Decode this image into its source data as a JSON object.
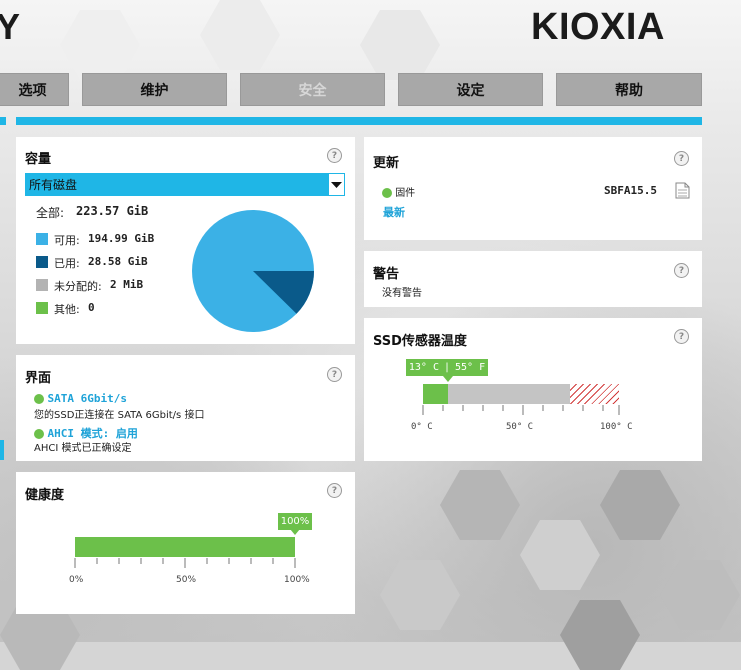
{
  "header": {
    "logo_left": "Y",
    "logo": "KIOXIA"
  },
  "nav": [
    {
      "label": "选项",
      "disabled": false
    },
    {
      "label": "维护",
      "disabled": false
    },
    {
      "label": "安全",
      "disabled": true
    },
    {
      "label": "设定",
      "disabled": false
    },
    {
      "label": "帮助",
      "disabled": false
    }
  ],
  "capacity": {
    "title": "容量",
    "select_value": "所有磁盘",
    "total_label": "全部:",
    "total_value": "223.57 GiB",
    "legend": [
      {
        "label": "可用:",
        "value": "194.99 GiB",
        "color": "#3bb1e6"
      },
      {
        "label": "已用:",
        "value": "28.58 GiB",
        "color": "#0a5a8a"
      },
      {
        "label": "未分配的:",
        "value": "2 MiB",
        "color": "#b3b3b3"
      },
      {
        "label": "其他:",
        "value": "0",
        "color": "#6cc04a"
      }
    ]
  },
  "interface": {
    "title": "界面",
    "sata_label": "SATA 6Gbit/s",
    "sata_desc": "您的SSD正连接在 SATA 6Gbit/s 接口",
    "ahci_label": "AHCI 模式: 启用",
    "ahci_desc": "AHCI 模式已正确设定"
  },
  "health": {
    "title": "健康度",
    "value_label": "100%",
    "percent": 100,
    "ticks": [
      "0%",
      "50%",
      "100%"
    ]
  },
  "update": {
    "title": "更新",
    "firmware_label": "固件",
    "firmware_version": "SBFA15.5",
    "status": "最新"
  },
  "warning": {
    "title": "警告",
    "text": "没有警告"
  },
  "temperature": {
    "title": "SSD传感器温度",
    "readout_c": "13° C",
    "readout_f": "55° F",
    "value_c": 13,
    "ticks": [
      "0° C",
      "50° C",
      "100° C"
    ]
  },
  "help_glyph": "?"
}
